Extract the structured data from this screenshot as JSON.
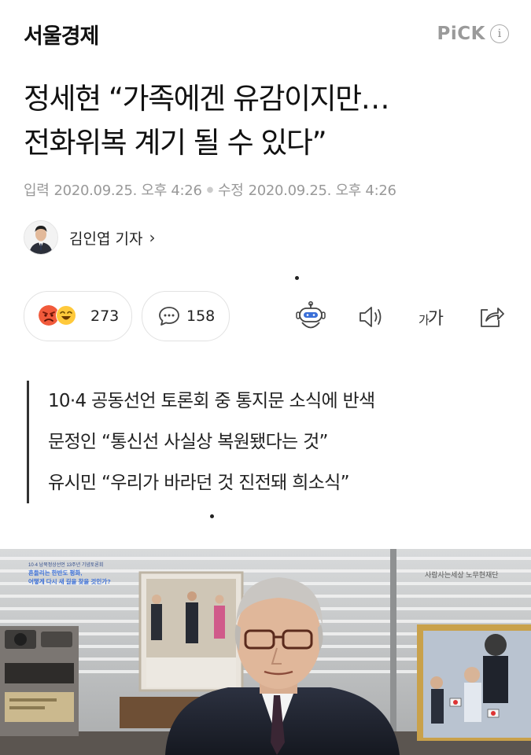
{
  "header": {
    "publisher": "서울경제",
    "pick_label": "PiCK",
    "info_glyph": "i"
  },
  "article": {
    "headline_lines": [
      "정세현 “가족에겐 유감이지만…",
      "전화위복 계기 될 수 있다”"
    ],
    "published_label": "입력",
    "published": "2020.09.25. 오후 4:26",
    "modified_label": "수정",
    "modified": "2020.09.25. 오후 4:26",
    "reporter": "김인엽 기자",
    "reporter_chevron": "›"
  },
  "toolbar": {
    "reaction_count": "273",
    "comment_count": "158",
    "font_size_label_small": "가",
    "font_size_label_large": "가",
    "icons": [
      "angry-emoji-icon",
      "laugh-emoji-icon",
      "comment-icon",
      "robot-summary-icon",
      "speaker-icon",
      "share-icon"
    ]
  },
  "summary": {
    "lines": [
      "10·4 공동선언 토론회 중 통지문 소식에 반색",
      "문정인 “통신선 사실상 복원됐다는 것”",
      "유시민 “우리가 바라던 것 진전돼 희소식”"
    ]
  },
  "photo": {
    "caption_lines": [
      "10·4 남북정상선언 13주년 기념토론회",
      "흔들리는 한반도 평화,",
      "어떻게 다시 새 길을 찾을 것인가?"
    ],
    "foundation_sign": "사람사는세상 노무현재단"
  },
  "colors": {
    "accent_blue": "#3a6fd8",
    "muted_gray": "#999999",
    "emoji_red": "#f15a3b",
    "emoji_yellow": "#ffc93b"
  }
}
